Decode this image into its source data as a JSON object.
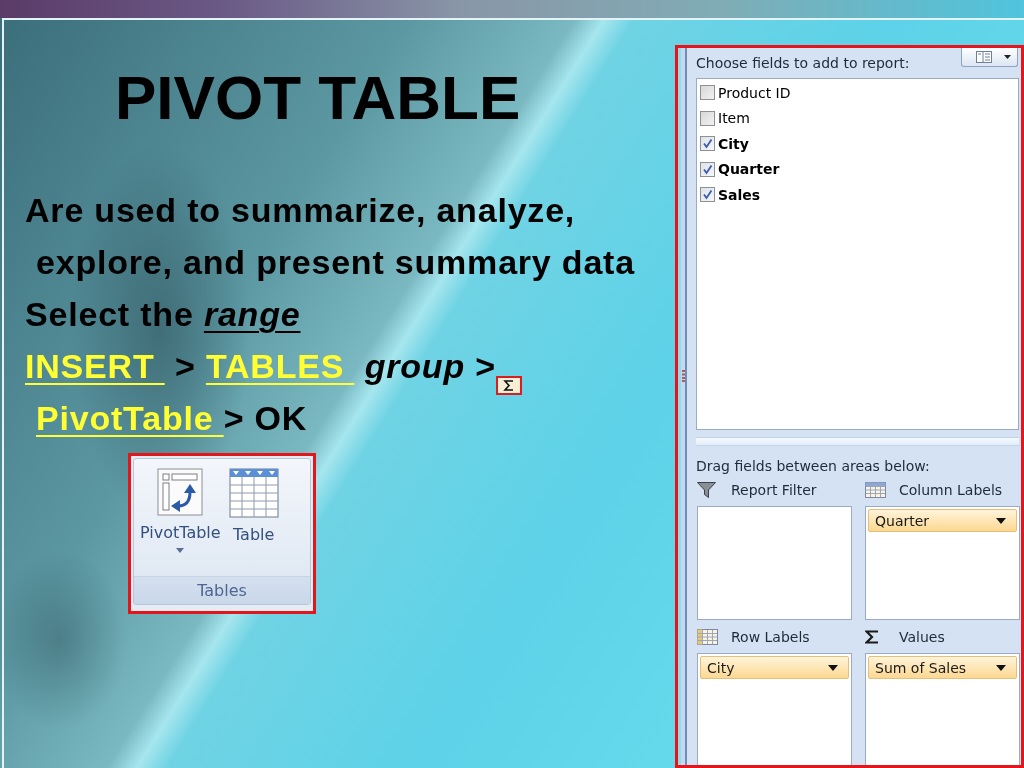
{
  "slide": {
    "title": "PIVOT TABLE",
    "lines": [
      {
        "has_icon": false,
        "indented": false,
        "segments": [
          {
            "kind": "plain",
            "text": "Are used to summarize, analyze,"
          }
        ]
      },
      {
        "has_icon": false,
        "indented": true,
        "segments": [
          {
            "kind": "plain",
            "text": "explore, and present summary data"
          }
        ]
      },
      {
        "has_icon": false,
        "indented": false,
        "segments": [
          {
            "kind": "plain",
            "text": "Select the "
          },
          {
            "kind": "emphasis",
            "text": "range"
          }
        ]
      },
      {
        "has_icon": true,
        "indented": false,
        "segments": [
          {
            "kind": "link",
            "text": "INSERT "
          },
          {
            "kind": "plain",
            "text": " > "
          },
          {
            "kind": "link",
            "text": "TABLES "
          },
          {
            "kind": "italic",
            "text": " group"
          },
          {
            "kind": "plain",
            "text": " >"
          }
        ]
      },
      {
        "has_icon": false,
        "indented": true,
        "segments": [
          {
            "kind": "link",
            "text": "PivotTable "
          },
          {
            "kind": "plain",
            "text": "> OK"
          }
        ]
      }
    ],
    "ribbon_group": {
      "buttons": [
        {
          "kind": "pivot_table",
          "label": "PivotTable",
          "dropdown": true
        },
        {
          "kind": "table",
          "label": "Table",
          "dropdown": false
        }
      ],
      "label": "Tables"
    }
  },
  "field_list": {
    "heading": "Choose fields to add to report:",
    "fields": [
      {
        "label": "Product ID",
        "checked": false
      },
      {
        "label": "Item",
        "checked": false
      },
      {
        "label": "City",
        "checked": true
      },
      {
        "label": "Quarter",
        "checked": true
      },
      {
        "label": "Sales",
        "checked": true
      }
    ],
    "areas_heading": "Drag fields between areas below:",
    "areas": [
      {
        "kind": "report_filter",
        "label": "Report Filter"
      },
      {
        "kind": "column_labels",
        "label": "Column Labels",
        "fields": [
          "Quarter"
        ]
      },
      {
        "kind": "row_labels",
        "label": "Row Labels",
        "fields": [
          "City"
        ]
      },
      {
        "kind": "values",
        "label": "Values",
        "fields": [
          "Sum of Sales"
        ]
      }
    ]
  }
}
